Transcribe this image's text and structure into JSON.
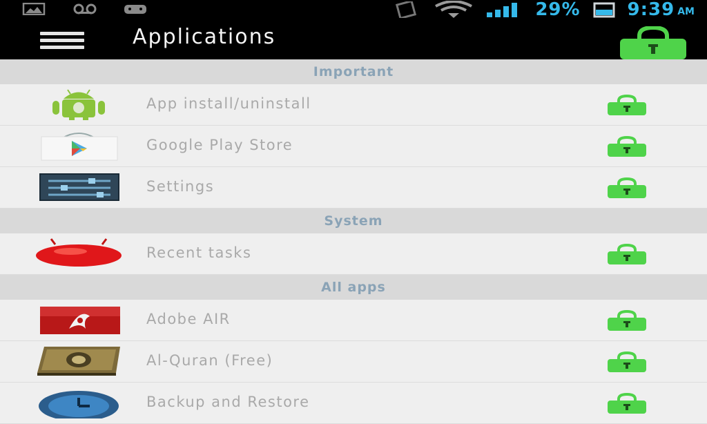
{
  "statusbar": {
    "battery": "29%",
    "time": "9:39",
    "ampm": "AM"
  },
  "header": {
    "title": "Applications"
  },
  "sections": [
    {
      "label": "Important",
      "items": [
        {
          "label": "App install/uninstall",
          "icon": "android-robot-icon"
        },
        {
          "label": "Google Play Store",
          "icon": "play-store-icon"
        },
        {
          "label": "Settings",
          "icon": "settings-sliders-icon"
        }
      ]
    },
    {
      "label": "System",
      "items": [
        {
          "label": "Recent tasks",
          "icon": "jellybean-icon"
        }
      ]
    },
    {
      "label": "All apps",
      "items": [
        {
          "label": "Adobe AIR",
          "icon": "adobe-air-icon"
        },
        {
          "label": "Al-Quran (Free)",
          "icon": "quran-book-icon"
        },
        {
          "label": "Backup and Restore",
          "icon": "backup-clock-icon"
        }
      ]
    }
  ],
  "colors": {
    "lock_green": "#4fd34a",
    "statusbar_blue": "#35b9ea",
    "section_text": "#8aa3b6"
  }
}
